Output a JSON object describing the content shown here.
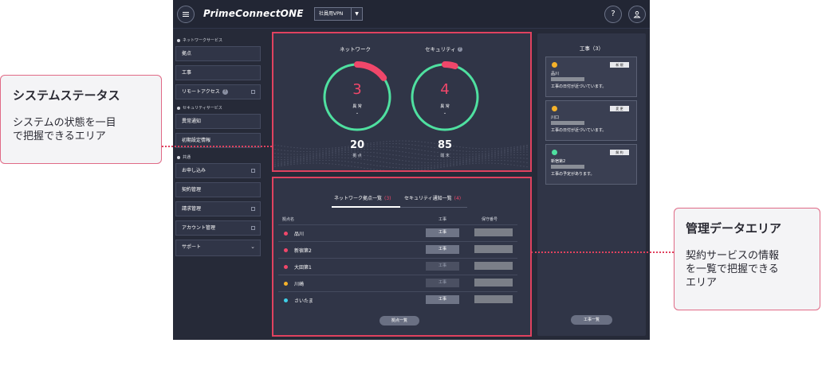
{
  "header": {
    "logo": "PrimeConnectONE",
    "vpn_select": "社員用VPN",
    "help_label": "?",
    "menu_icon": "hamburger-icon",
    "user_icon": "user-icon"
  },
  "sidebar": {
    "sections": [
      {
        "label": "ネットワークサービス"
      },
      {
        "label": "セキュリティサービス"
      },
      {
        "label": "共通"
      }
    ],
    "items": [
      {
        "label": "拠点"
      },
      {
        "label": "工事"
      },
      {
        "label": "リモートアクセス",
        "badge": "?"
      },
      {
        "label": "異常通知"
      },
      {
        "label": "初期設定情報"
      },
      {
        "label": "お申し込み"
      },
      {
        "label": "契約管理"
      },
      {
        "label": "請求管理"
      },
      {
        "label": "アカウント管理"
      },
      {
        "label": "サポート",
        "chevron": "⌄"
      }
    ]
  },
  "status": {
    "network": {
      "title": "ネットワーク",
      "value": "3",
      "sub": "異 常",
      "count": "20",
      "count_label": "拠 点",
      "fraction": 0.15
    },
    "security": {
      "title": "セキュリティ",
      "value": "4",
      "sub": "異 常",
      "count": "85",
      "count_label": "端 末",
      "fraction": 0.05
    },
    "colors": {
      "alert": "#f0476a",
      "ok": "#4fe0a0"
    }
  },
  "data": {
    "tabs": [
      {
        "label": "ネットワーク拠点一覧",
        "count": "(3)"
      },
      {
        "label": "セキュリティ通知一覧",
        "count": "(4)"
      }
    ],
    "columns": {
      "name": "拠点名",
      "work": "工事",
      "number": "保守番号"
    },
    "rows": [
      {
        "name": "品川",
        "status_color": "#f0476a",
        "work": "工事",
        "dim": false
      },
      {
        "name": "新宿第2",
        "status_color": "#f0476a",
        "work": "工事",
        "dim": false
      },
      {
        "name": "大田第1",
        "status_color": "#f0476a",
        "work": "工事",
        "dim": true
      },
      {
        "name": "川崎",
        "status_color": "#f5b22a",
        "work": "工事",
        "dim": true
      },
      {
        "name": "さいたま",
        "status_color": "#3fd0e8",
        "work": "工事",
        "dim": false
      }
    ],
    "list_button": "拠点一覧"
  },
  "construction": {
    "title": "工事（3）",
    "cards": [
      {
        "tag": "新 規",
        "name": "品川",
        "msg": "工事の日付が近づいています。",
        "color": "#f5b22a"
      },
      {
        "tag": "変 更",
        "name": "川口",
        "msg": "工事の日付が近づいています。",
        "color": "#f5b22a"
      },
      {
        "tag": "解 約",
        "name": "新宿第2",
        "msg": "工事の予定があります。",
        "color": "#4fe0a0"
      }
    ],
    "list_button": "工事一覧"
  },
  "callouts": {
    "system": {
      "title": "システムステータス",
      "body1": "システムの状態を一目",
      "body2": "で把握できるエリア"
    },
    "management": {
      "title": "管理データエリア",
      "body1": "契約サービスの情報",
      "body2": "を一覧で把握できる",
      "body3": "エリア"
    }
  }
}
